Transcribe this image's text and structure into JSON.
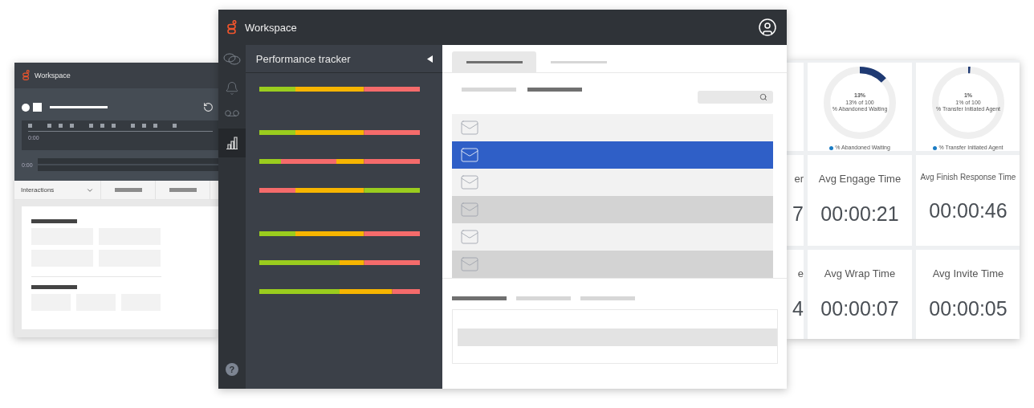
{
  "left_window": {
    "title": "Workspace",
    "timeline_label": "0:00",
    "track_label": "0:00",
    "dropdown_label": "Interactions"
  },
  "main_window": {
    "title": "Workspace",
    "rail": [
      {
        "kind": "chat",
        "selected": false
      },
      {
        "kind": "bell",
        "selected": false
      },
      {
        "kind": "voicemail",
        "selected": false
      },
      {
        "kind": "chart",
        "selected": true
      }
    ],
    "help": "?",
    "panel": {
      "title": "Performance tracker"
    },
    "tabs": [
      {
        "selected": true
      },
      {
        "selected": false
      }
    ],
    "sub_tabs": [
      {
        "selected": false
      },
      {
        "selected": true
      }
    ],
    "rows": [
      {
        "kind": "plain",
        "selected": false
      },
      {
        "kind": "plain",
        "selected": true
      },
      {
        "kind": "plain",
        "selected": false
      },
      {
        "kind": "shaded",
        "selected": false
      },
      {
        "kind": "plain",
        "selected": false
      },
      {
        "kind": "shaded",
        "selected": false
      }
    ],
    "detail_tabs": [
      {
        "selected": true
      },
      {
        "selected": false
      },
      {
        "selected": false
      }
    ]
  },
  "dashboard": {
    "partial_cards": [
      {
        "label": "er",
        "value": "7"
      },
      {
        "label": "e",
        "value": "4"
      }
    ],
    "donuts": [
      {
        "percent": "13%",
        "detail": "13% of 100",
        "caption": "% Abandoned Waiting",
        "legend": "% Abandoned Waiting",
        "level": 0.13
      },
      {
        "percent": "1%",
        "detail": "1% of 100",
        "caption": "% Transfer Initiated Agent",
        "legend": "% Transfer Initiated Agent",
        "level": 0.01
      }
    ],
    "metrics": [
      {
        "label": "Avg Engage Time",
        "value": "00:00:21"
      },
      {
        "label": "Avg Finish Response Time",
        "value": "00:00:46"
      },
      {
        "label": "Avg Wrap Time",
        "value": "00:00:07"
      },
      {
        "label": "Avg Invite Time",
        "value": "00:00:05"
      }
    ]
  }
}
